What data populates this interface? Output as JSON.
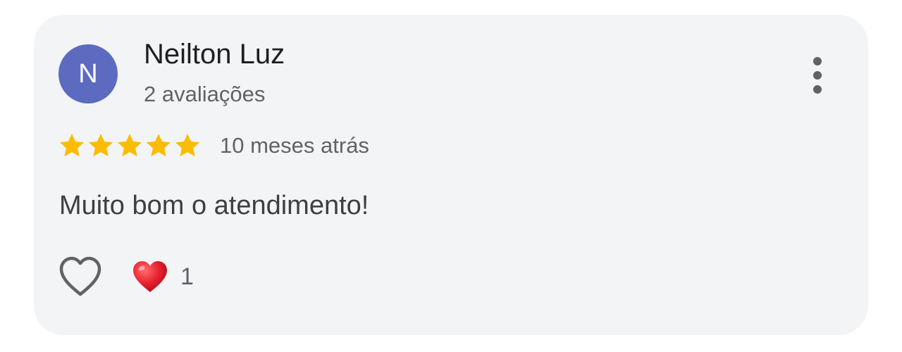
{
  "review": {
    "author": {
      "initial": "N",
      "name": "Neilton Luz",
      "reviews_count": "2 avaliações",
      "avatar_color": "#5c6bc0"
    },
    "rating": 5,
    "max_rating": 5,
    "star_color": "#fbbc04",
    "date": "10 meses atrás",
    "text": "Muito bom o atendimento!",
    "reactions": {
      "like_icon": "heart-outline-icon",
      "reaction_icon": "red-heart-icon",
      "count": "1"
    },
    "menu_icon": "more-vert-icon"
  }
}
